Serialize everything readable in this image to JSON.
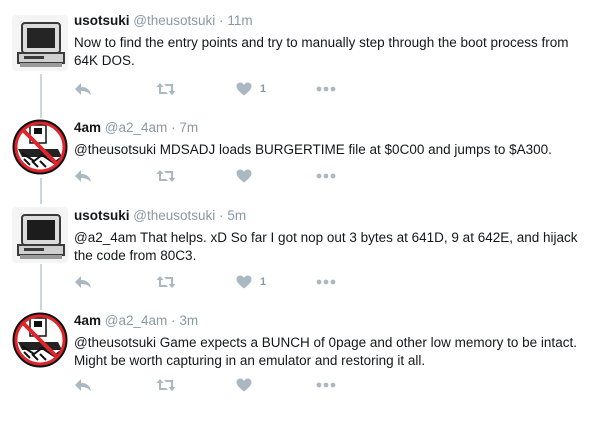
{
  "tweets": [
    {
      "name": "usotsuki",
      "handle": "@theusotsuki",
      "dot": "·",
      "time": "11m",
      "avatar": "retro-computer-avatar",
      "text": "Now to find the entry points and try to manually step through the boot process from 64K DOS.",
      "likes": "1"
    },
    {
      "name": "4am",
      "handle": "@a2_4am",
      "dot": "·",
      "time": "7m",
      "avatar": "no-disk-copying-avatar",
      "text": "@theusotsuki MDSADJ loads BURGERTIME file at $0C00 and jumps to $A300.",
      "likes": ""
    },
    {
      "name": "usotsuki",
      "handle": "@theusotsuki",
      "dot": "·",
      "time": "5m",
      "avatar": "retro-computer-avatar",
      "text": "@a2_4am That helps. xD  So far I got nop out 3 bytes at 641D, 9 at 642E, and hijack the code from 80C3.",
      "likes": "1"
    },
    {
      "name": "4am",
      "handle": "@a2_4am",
      "dot": "·",
      "time": "3m",
      "avatar": "no-disk-copying-avatar",
      "text": "@theusotsuki Game expects a BUNCH of 0page and other low memory to be intact. Might be worth capturing in an emulator and restoring it all.",
      "likes": ""
    }
  ],
  "colors": {
    "icon": "#aab8c2",
    "meta": "#8899a6",
    "thread_line": "#ccd6dd",
    "no_sign": "#e0242b"
  }
}
